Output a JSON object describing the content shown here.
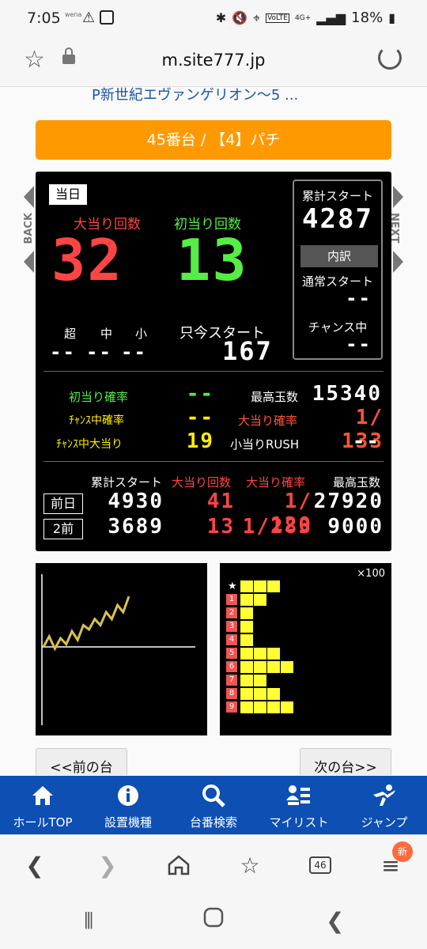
{
  "status_bar": {
    "time": "7:05",
    "wena": "wena",
    "battery": "18%",
    "network": "4G+",
    "volte": "VoLTE"
  },
  "address_bar": {
    "url": "m.site777.jp"
  },
  "page": {
    "machine_name": "P新世紀エヴァンゲリオン～5 ...",
    "title": "45番台 / 【4】パチ",
    "back_label": "BACK",
    "next_label": "NEXT"
  },
  "today": {
    "badge": "当日",
    "big_hits_label": "大当り回数",
    "big_hits_value": "32",
    "first_hits_label": "初当り回数",
    "first_hits_value": "13",
    "super_label": "超",
    "mid_label": "中",
    "small_label": "小",
    "super_value": "--",
    "mid_value": "--",
    "small_value": "--",
    "current_start_label": "只今スタート",
    "current_start_value": "167"
  },
  "right_box": {
    "cum_start_label": "累計スタート",
    "cum_start_value": "4287",
    "breakdown_label": "内訳",
    "normal_start_label": "通常スタート",
    "normal_start_value": "--",
    "chance_label": "チャンス中",
    "chance_value": "--"
  },
  "stats": {
    "first_prob_label": "初当り確率",
    "first_prob_value": "--",
    "chance_prob_label": "ﾁｬﾝｽ中確率",
    "chance_prob_value": "--",
    "chance_big_label": "ﾁｬﾝｽ中大当り",
    "chance_big_value": "19",
    "max_balls_label": "最高玉数",
    "max_balls_value": "15340",
    "big_prob_label": "大当り確率",
    "big_prob_value": "1/ 133",
    "small_rush_label": "小当りRUSH",
    "small_rush_value": "--"
  },
  "history": {
    "headers": [
      "累計スタート",
      "大当り回数",
      "大当り確率",
      "最高玉数"
    ],
    "rows": [
      {
        "label": "前日",
        "cum_start": "4930",
        "hits": "41",
        "prob": "1/ 120",
        "max_balls": "27920"
      },
      {
        "label": "2前",
        "cum_start": "3689",
        "hits": "13",
        "prob": "1/283",
        "max_balls": "9000"
      }
    ]
  },
  "distribution": {
    "unit": "×100",
    "star": "★",
    "row_labels": [
      "1",
      "2",
      "3",
      "4",
      "5",
      "6",
      "7",
      "8",
      "9"
    ],
    "star_cells": 3,
    "cells": [
      2,
      1,
      1,
      1,
      3,
      4,
      2,
      3,
      4
    ]
  },
  "graph": {
    "points": [
      0.3,
      0.42,
      0.28,
      0.4,
      0.33,
      0.48,
      0.38,
      0.55,
      0.5,
      0.62,
      0.55,
      0.7,
      0.62,
      0.78,
      0.7,
      0.88
    ]
  },
  "nav_buttons": {
    "prev": "<<前の台",
    "next": "次の台>>"
  },
  "site_nav": [
    {
      "label": "ホールTOP",
      "icon": "home-icon"
    },
    {
      "label": "設置機種",
      "icon": "info-icon"
    },
    {
      "label": "台番検索",
      "icon": "search-icon"
    },
    {
      "label": "マイリスト",
      "icon": "mylist-icon"
    },
    {
      "label": "ジャンプ",
      "icon": "jump-icon"
    }
  ],
  "browser_bar": {
    "tabs_count": "46",
    "new_badge": "新"
  },
  "colors": {
    "accent_orange": "#ff9900",
    "nav_blue": "#0d4fb3",
    "hit_red": "#ff4444",
    "hit_green": "#55ee44",
    "yellow": "#ffee00"
  }
}
